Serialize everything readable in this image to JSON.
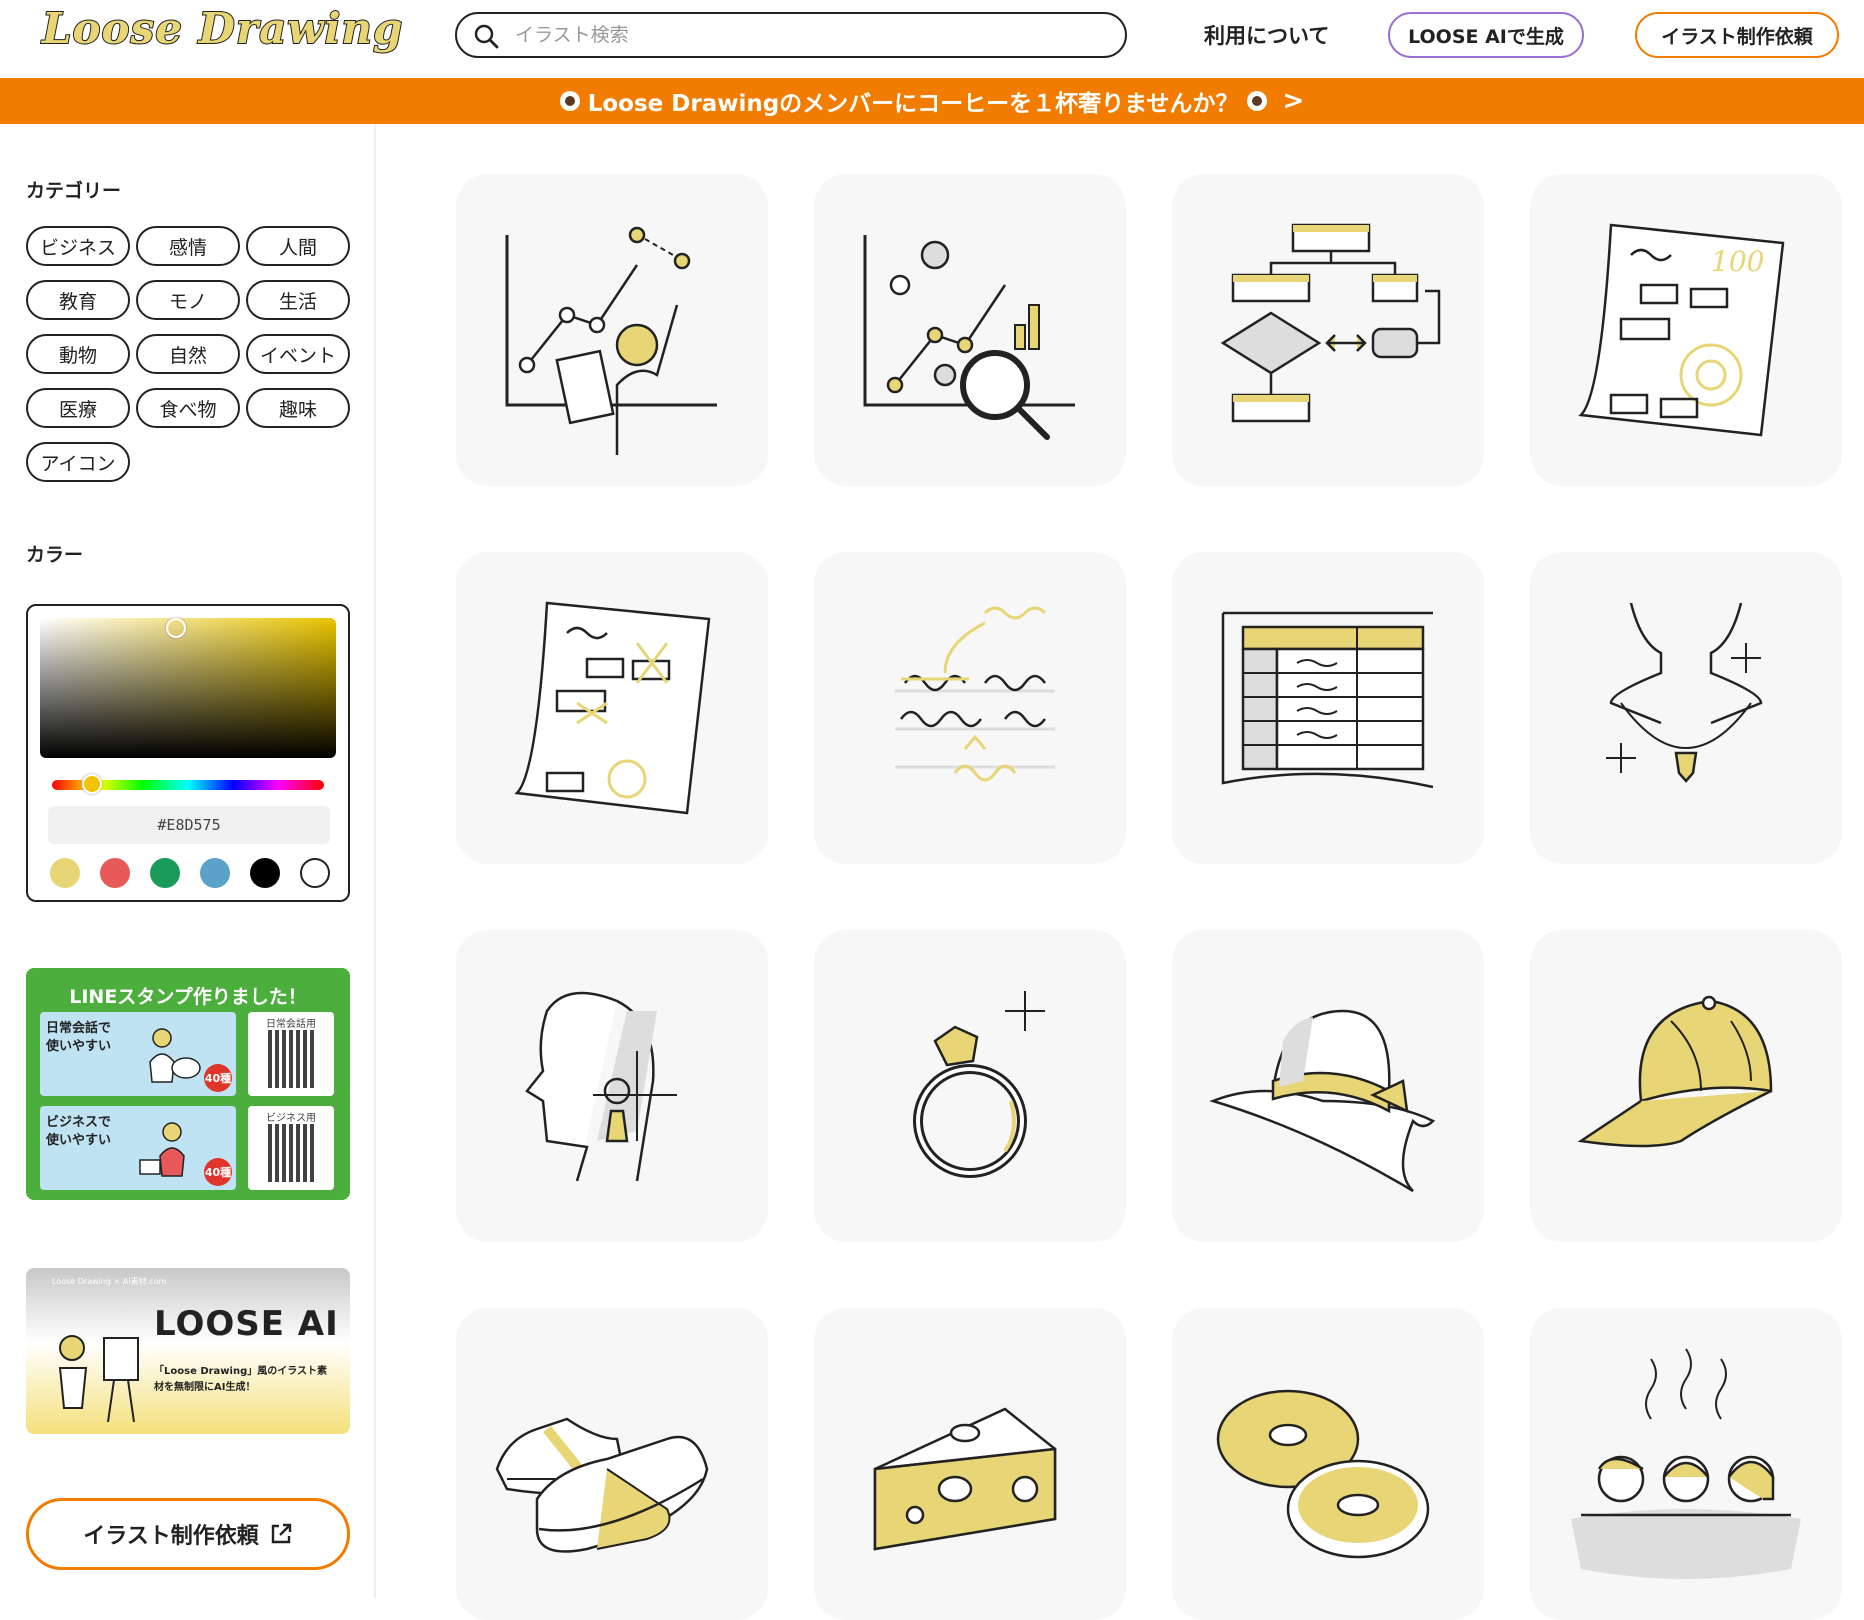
{
  "header": {
    "logo": "Loose Drawing",
    "search_placeholder": "イラスト検索",
    "about": "利用について",
    "ai_button": "LOOSE AIで生成",
    "request_button": "イラスト制作依頼"
  },
  "banner": {
    "text": "Loose Drawingのメンバーにコーヒーを１杯奢りませんか？",
    "arrow": ">"
  },
  "sidebar": {
    "category_title": "カテゴリー",
    "categories": [
      "ビジネス",
      "感情",
      "人間",
      "教育",
      "モノ",
      "生活",
      "動物",
      "自然",
      "イベント",
      "医療",
      "食べ物",
      "趣味",
      "アイコン"
    ],
    "color_title": "カラー",
    "color_hex": "#E8D575",
    "swatches": [
      "#e8d575",
      "#e85a5a",
      "#1a9b5a",
      "#5aa2c8",
      "#000000",
      "#ffffff"
    ],
    "line_title": "LINEスタンプ作りました！",
    "line_panel1": "日常会話で\n使いやすい",
    "line_panel2": "ビジネスで\n使いやすい",
    "line_badge": "40種",
    "line_qr1": "日常会話用",
    "line_qr2": "ビジネス用",
    "ai_small": "Loose Drawing × AI素材.com",
    "ai_big": "LOOSE AI",
    "ai_sub": "「Loose Drawing」風のイラスト素材を無制限にAI生成！",
    "request_big": "イラスト制作依頼"
  },
  "illustrations": [
    "chart-person-icon",
    "data-analysis-icon",
    "flowchart-icon",
    "test-paper-100-icon",
    "test-paper-marked-icon",
    "handwriting-correction-icon",
    "table-sheet-icon",
    "necklace-icon",
    "earring-profile-icon",
    "ring-icon",
    "hat-icon",
    "cap-icon",
    "sneakers-icon",
    "cheese-icon",
    "donuts-icon",
    "hot-spring-icon"
  ],
  "colors": {
    "accent": "#e8d575",
    "orange": "#f27c00",
    "purple": "#9b6fd6",
    "line_green": "#4cae3c"
  }
}
